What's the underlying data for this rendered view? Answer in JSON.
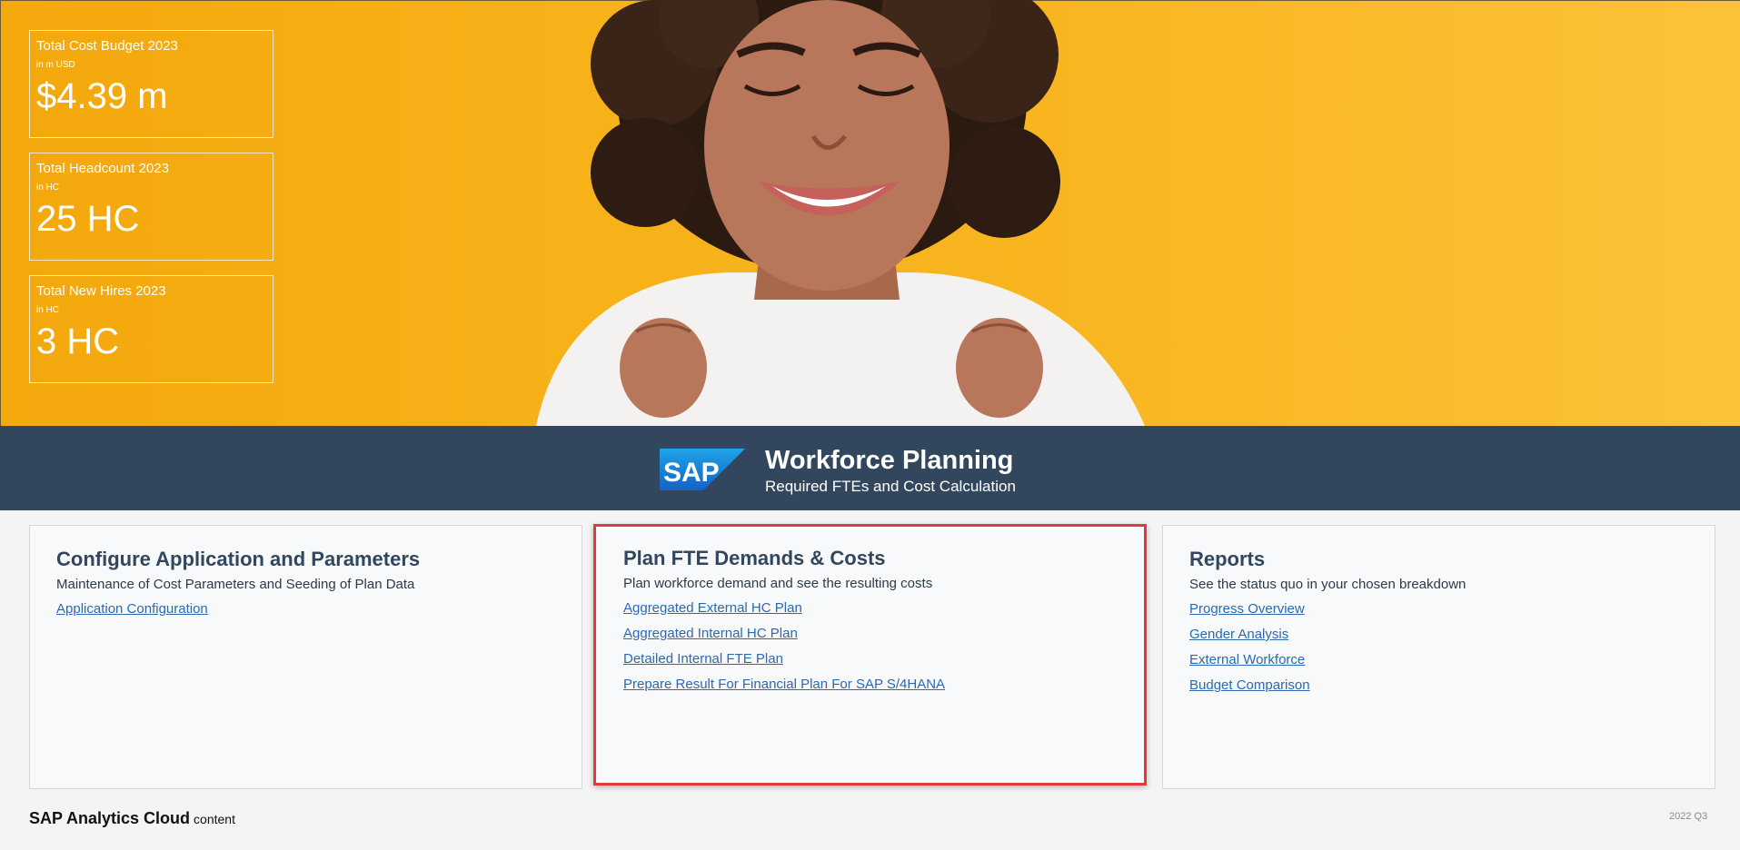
{
  "kpis": [
    {
      "title": "Total Cost Budget 2023",
      "unit": "in m USD",
      "value": "$4.39 m"
    },
    {
      "title": "Total Headcount 2023",
      "unit": "in HC",
      "value": "25 HC"
    },
    {
      "title": "Total New Hires 2023",
      "unit": "in HC",
      "value": "3 HC"
    }
  ],
  "banner": {
    "logo_text": "SAP",
    "title": "Workforce Planning",
    "subtitle": "Required FTEs and Cost Calculation"
  },
  "cards": [
    {
      "title": "Configure Application and Parameters",
      "subtitle": "Maintenance of Cost Parameters and Seeding of Plan Data",
      "links": [
        "Application Configuration"
      ]
    },
    {
      "title": "Plan FTE Demands & Costs",
      "subtitle": "Plan workforce demand and see the resulting costs",
      "links": [
        "Aggregated External HC Plan",
        "Aggregated Internal HC Plan",
        "Detailed Internal FTE Plan",
        "Prepare Result For Financial Plan For SAP S/4HANA"
      ]
    },
    {
      "title": "Reports",
      "subtitle": "See the status quo in your chosen breakdown",
      "links": [
        "Progress Overview",
        "Gender Analysis",
        "External Workforce",
        "Budget Comparison"
      ]
    }
  ],
  "footer": {
    "brand": "SAP Analytics Cloud",
    "brand_suffix": "content",
    "version": "2022 Q3"
  },
  "colors": {
    "hero_orange": "#f7b21a",
    "banner_navy": "#32475e",
    "link_blue": "#2b69b3",
    "highlight_red": "#e0393a"
  }
}
